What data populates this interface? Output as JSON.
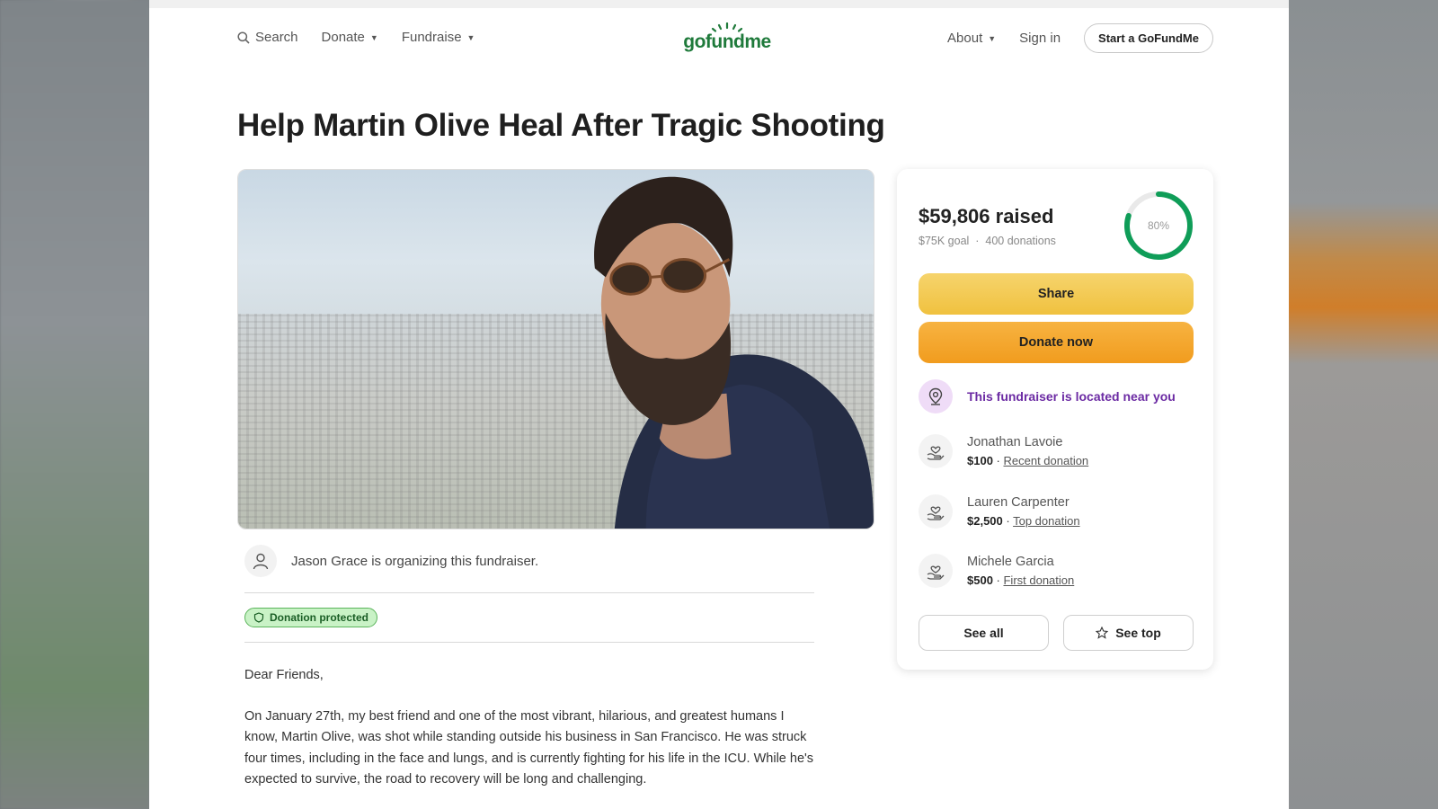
{
  "nav": {
    "search_label": "Search",
    "donate_label": "Donate",
    "fundraise_label": "Fundraise",
    "logo_text": "gofundme",
    "about_label": "About",
    "signin_label": "Sign in",
    "start_label": "Start a GoFundMe"
  },
  "campaign": {
    "title": "Help Martin Olive Heal After Tragic Shooting",
    "organizer_text": "Jason Grace is organizing this fundraiser.",
    "protected_badge": "Donation protected",
    "story": [
      "Dear Friends,",
      "On January 27th, my best friend and one of the most vibrant, hilarious, and greatest humans I know, Martin Olive, was shot while standing outside his business in San Francisco. He was struck four times, including in the face and lungs, and is currently fighting for his life in the ICU. While he's expected to survive, the road to recovery will be long and challenging."
    ]
  },
  "stats": {
    "raised": "$59,806 raised",
    "goal": "$75K goal",
    "separator": "·",
    "donations": "400 donations",
    "percent_label": "80%",
    "percent_value": 0.8
  },
  "actions": {
    "share_label": "Share",
    "donate_label": "Donate now",
    "near_text": "This fundraiser is located near you",
    "see_all_label": "See all",
    "see_top_label": "See top"
  },
  "donors": [
    {
      "name": "Jonathan Lavoie",
      "amount": "$100",
      "tag": "Recent donation"
    },
    {
      "name": "Lauren Carpenter",
      "amount": "$2,500",
      "tag": "Top donation"
    },
    {
      "name": "Michele Garcia",
      "amount": "$500",
      "tag": "First donation"
    }
  ],
  "colors": {
    "brand_green": "#1f7a3b",
    "ring_green": "#0f9d58",
    "share_yellow": "#f0c13f",
    "donate_orange": "#f19c1e",
    "near_purple": "#6b2aa3"
  },
  "icons": {
    "search": "search-icon",
    "location": "location-pin-icon",
    "donor": "heart-hand-icon",
    "star": "star-icon",
    "shield": "shield-icon",
    "user": "user-icon"
  }
}
